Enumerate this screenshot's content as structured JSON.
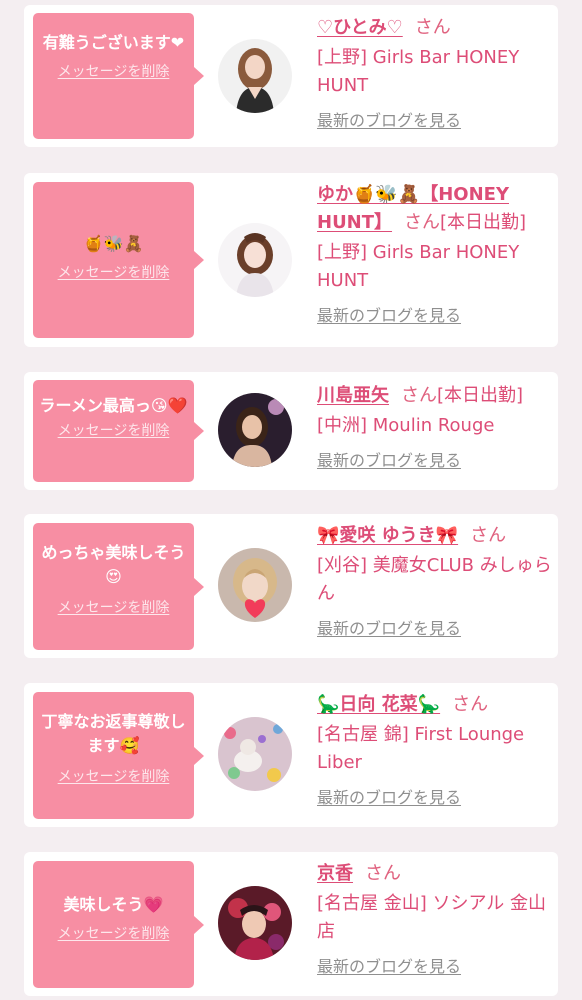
{
  "messages": [
    {
      "message": "有難うございます❤",
      "delete_label": "メッセージを削除",
      "name": "♡ひとみ♡",
      "honorific": "さん",
      "status": "",
      "shop": "[上野] Girls Bar HONEY HUNT",
      "blog_label": "最新のブログを見る"
    },
    {
      "message": "🍯🐝🧸",
      "delete_label": "メッセージを削除",
      "name": "ゆか🍯🐝🧸【HONEY HUNT】",
      "honorific": "さん",
      "status": "[本日出勤]",
      "shop": "[上野] Girls Bar HONEY HUNT",
      "blog_label": "最新のブログを見る"
    },
    {
      "message": "ラーメン最高っ😘❤️",
      "delete_label": "メッセージを削除",
      "name": "川島亜矢",
      "honorific": "さん",
      "status": "[本日出勤]",
      "shop": "[中洲] Moulin Rouge",
      "blog_label": "最新のブログを見る"
    },
    {
      "message": "めっちゃ美味しそう😍",
      "delete_label": "メッセージを削除",
      "name": "🎀愛咲 ゆうき🎀",
      "honorific": "さん",
      "status": "",
      "shop": "[刈谷] 美魔女CLUB みしゅらん",
      "blog_label": "最新のブログを見る"
    },
    {
      "message": "丁寧なお返事尊敬します🥰",
      "delete_label": "メッセージを削除",
      "name": "🦕日向 花菜🦕",
      "honorific": "さん",
      "status": "",
      "shop": "[名古屋 錦] First Lounge Liber",
      "blog_label": "最新のブログを見る"
    },
    {
      "message": "美味しそう💗",
      "delete_label": "メッセージを削除",
      "name": "京香",
      "honorific": "さん",
      "status": "",
      "shop": "[名古屋 金山] ソシアル 金山店",
      "blog_label": "最新のブログを見る"
    }
  ],
  "colors": {
    "bubble": "#f78ea3",
    "accent": "#dd4d77",
    "link_gray": "#8f8f8f",
    "page_bg": "#f4eef1"
  }
}
